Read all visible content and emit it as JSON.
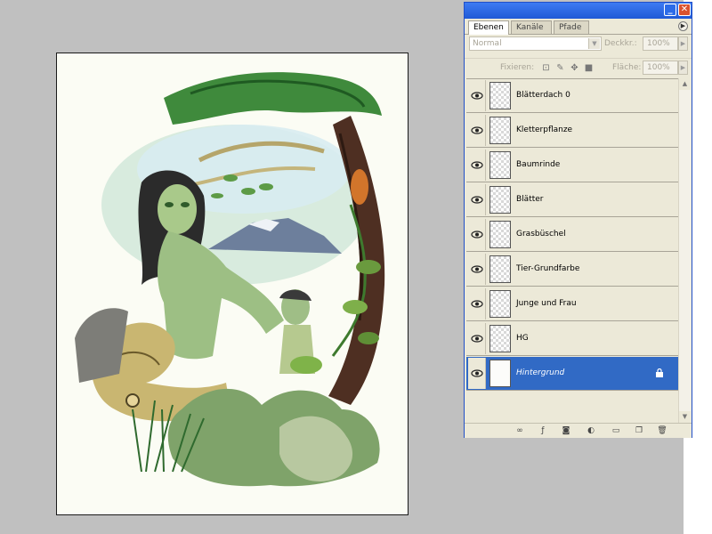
{
  "palette": {
    "tabs": [
      "Ebenen",
      "Kanäle",
      "Pfade"
    ],
    "blend_mode": "Normal",
    "opacity_label": "Deckkr.:",
    "opacity_value": "100%",
    "lock_label": "Fixieren:",
    "fill_label": "Fläche:",
    "fill_value": "100%",
    "layers": [
      {
        "name": "Blätterdach 0",
        "visible": true,
        "selected": false
      },
      {
        "name": "Kletterpflanze",
        "visible": true,
        "selected": false
      },
      {
        "name": "Baumrinde",
        "visible": true,
        "selected": false
      },
      {
        "name": "Blätter",
        "visible": true,
        "selected": false
      },
      {
        "name": "Grasbüschel",
        "visible": true,
        "selected": false
      },
      {
        "name": "Tier-Grundfarbe",
        "visible": true,
        "selected": false
      },
      {
        "name": "Junge und Frau",
        "visible": true,
        "selected": false
      },
      {
        "name": "HG",
        "visible": true,
        "selected": false
      },
      {
        "name": "Hintergrund",
        "visible": true,
        "selected": true,
        "locked": true
      }
    ],
    "colors": {
      "title": "#2a63df",
      "selected": "#316ac5",
      "panel": "#ece9d8"
    }
  },
  "bottom_icons": [
    "link-icon",
    "layer-style-icon",
    "mask-icon",
    "adjustment-layer-icon",
    "group-folder-icon",
    "new-layer-icon",
    "trash-icon"
  ]
}
